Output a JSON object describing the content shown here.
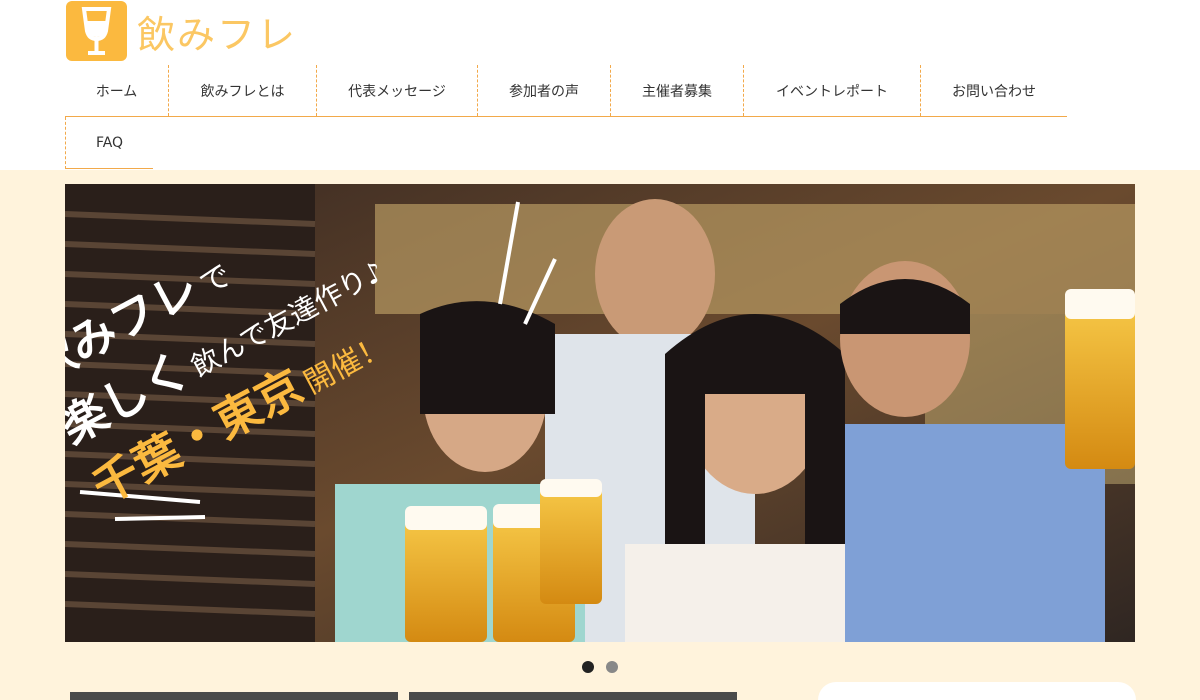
{
  "site": {
    "logo_text": "飲みフレ",
    "brand_color": "#fbb93f",
    "accent_line_color": "#f2a94a",
    "background_band": "#fff3dc"
  },
  "nav": {
    "items": [
      {
        "label": "ホーム"
      },
      {
        "label": "飲みフレとは"
      },
      {
        "label": "代表メッセージ"
      },
      {
        "label": "参加者の声"
      },
      {
        "label": "主催者募集"
      },
      {
        "label": "イベントレポート"
      },
      {
        "label": "お問い合わせ"
      },
      {
        "label": "FAQ"
      }
    ]
  },
  "hero": {
    "line1_a": "飲みフレ",
    "line1_b": "で",
    "line2_a": "楽しく",
    "line2_b": "飲んで友達作り♪",
    "line3_a": "千葉・東京",
    "line3_b": "開催！",
    "slides_total": 2,
    "active_slide": 1
  }
}
